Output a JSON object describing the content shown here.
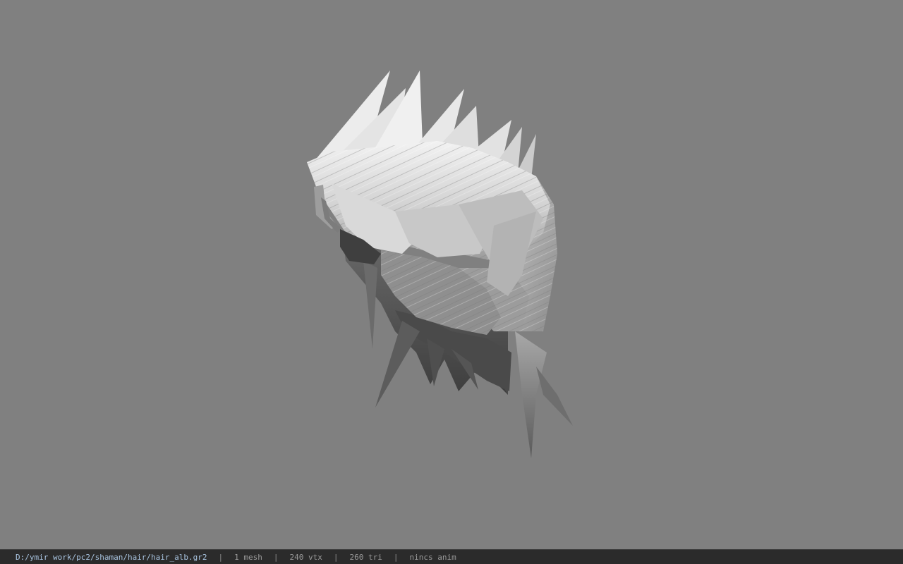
{
  "viewer": {
    "background_color": "#808080",
    "model_name": "hair_alb.gr2"
  },
  "status_bar": {
    "file_path": "D:/ymir work/pc2/shaman/hair/hair_alb.gr2",
    "mesh_count": "1 mesh",
    "vertex_count": "240 vtx",
    "triangle_count": "260 tri",
    "anim_status": "nincs anim",
    "separator": "|",
    "path_color": "#a9c4e0",
    "text_color": "#9a9a9a"
  }
}
